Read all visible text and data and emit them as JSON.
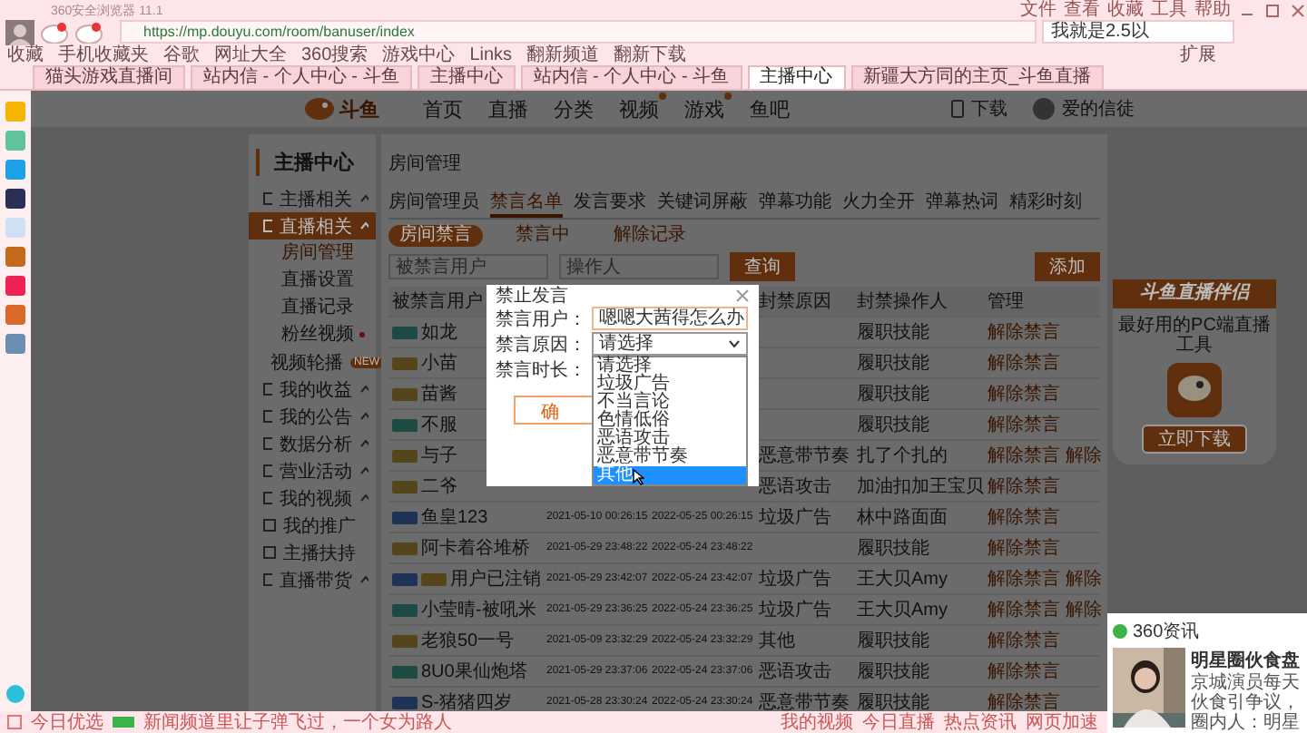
{
  "browser": {
    "title": "360安全浏览器 11.1",
    "url": "https://mp.douyu.com/room/banuser/index",
    "search": "我就是2.5以",
    "menu": [
      "文件",
      "查看",
      "收藏",
      "工具",
      "帮助"
    ],
    "bookmarks": [
      "收藏",
      "手机收藏夹",
      "谷歌",
      "网址大全",
      "360搜索",
      "游戏中心",
      "Links",
      "翻新频道",
      "翻新下载"
    ],
    "bookmarks_right": [
      "扩展"
    ],
    "tabs": [
      {
        "label": "猫头游戏直播间",
        "selected": false
      },
      {
        "label": "站内信 - 个人中心 - 斗鱼",
        "selected": false
      },
      {
        "label": "主播中心",
        "selected": false
      },
      {
        "label": "站内信 - 个人中心 - 斗鱼",
        "selected": false
      },
      {
        "label": "主播中心",
        "selected": true
      },
      {
        "label": "新疆大方同的主页_斗鱼直播",
        "selected": false
      }
    ]
  },
  "site": {
    "logo": "斗鱼",
    "nav": [
      {
        "label": "首页",
        "badge": false
      },
      {
        "label": "直播",
        "badge": false
      },
      {
        "label": "分类",
        "badge": false
      },
      {
        "label": "视频",
        "badge": true
      },
      {
        "label": "游戏",
        "badge": true
      },
      {
        "label": "鱼吧",
        "badge": false
      }
    ],
    "download": "下载",
    "username": "爱的信徒"
  },
  "side_menu": {
    "title": "主播中心",
    "items": [
      {
        "label": "主播相关",
        "expandable": true,
        "selected": false
      },
      {
        "label": "直播相关",
        "expandable": true,
        "selected": true,
        "children": [
          {
            "label": "房间管理",
            "selected": true,
            "dot": false
          },
          {
            "label": "直播设置",
            "selected": false,
            "dot": false
          },
          {
            "label": "直播记录",
            "selected": false,
            "dot": false
          },
          {
            "label": "粉丝视频",
            "selected": false,
            "dot": true
          }
        ]
      },
      {
        "label": "视频轮播",
        "expandable": false,
        "selected": false,
        "badge": "NEW"
      },
      {
        "label": "我的收益",
        "expandable": true,
        "selected": false
      },
      {
        "label": "我的公告",
        "expandable": true,
        "selected": false
      },
      {
        "label": "数据分析",
        "expandable": true,
        "selected": false
      },
      {
        "label": "营业活动",
        "expandable": true,
        "selected": false
      },
      {
        "label": "我的视频",
        "expandable": true,
        "selected": false
      },
      {
        "label": "我的推广",
        "expandable": false,
        "selected": false
      },
      {
        "label": "主播扶持",
        "expandable": false,
        "selected": false
      },
      {
        "label": "直播带货",
        "expandable": true,
        "selected": false
      }
    ]
  },
  "main": {
    "title": "房间管理",
    "tabs": [
      {
        "label": "房间管理员",
        "selected": false
      },
      {
        "label": "禁言名单",
        "selected": true
      },
      {
        "label": "发言要求",
        "selected": false
      },
      {
        "label": "关键词屏蔽",
        "selected": false
      },
      {
        "label": "弹幕功能",
        "selected": false
      },
      {
        "label": "火力全开",
        "selected": false
      },
      {
        "label": "弹幕热词",
        "selected": false
      },
      {
        "label": "精彩时刻",
        "selected": false
      }
    ],
    "filters": [
      {
        "label": "房间禁言",
        "selected": true
      },
      {
        "label": "禁言中",
        "selected": false
      },
      {
        "label": "解除记录",
        "selected": false
      }
    ],
    "search": [
      {
        "placeholder": "被禁言用户"
      },
      {
        "placeholder": "操作人"
      }
    ],
    "query_button": "查询",
    "add_button": "添加",
    "table": {
      "columns": {
        "column_1": "被禁言用户",
        "column_4": "封禁原因",
        "column_5": "封禁操作人",
        "column_6": "管理"
      },
      "rows": [
        {
          "badges": [
            {
              "color": "#1e4a44"
            }
          ],
          "user": "如龙",
          "operator": "履职技能",
          "actions": [
            "解除禁言"
          ]
        },
        {
          "badges": [
            {
              "color": "#54461a"
            }
          ],
          "user": "小苗",
          "operator": "履职技能",
          "actions": [
            "解除禁言"
          ]
        },
        {
          "badges": [
            {
              "color": "#54461a"
            }
          ],
          "user": "苗酱",
          "operator": "履职技能",
          "actions": [
            "解除禁言"
          ]
        },
        {
          "badges": [
            {
              "color": "#1e4a44"
            }
          ],
          "user": "不服",
          "operator": "履职技能",
          "actions": [
            "解除禁言"
          ]
        },
        {
          "badges": [
            {
              "color": "#54461a"
            }
          ],
          "user": "与子",
          "reason": "恶意带节奏",
          "operator": "扎了个扎的",
          "actions": [
            "解除禁言",
            "解除"
          ]
        },
        {
          "badges": [
            {
              "color": "#54461a"
            }
          ],
          "user": "二爷",
          "reason": "恶语攻击",
          "operator": "加油扣加王宝贝",
          "actions": [
            "解除禁言"
          ]
        },
        {
          "badges": [
            {
              "color": "#1e3356"
            }
          ],
          "user": "鱼皇123",
          "banned": "2021-05-10 00:26:15",
          "expires": "2022-05-25 00:26:15",
          "reason": "垃圾广告",
          "operator": "林中路面面",
          "actions": [
            "解除禁言"
          ]
        },
        {
          "badges": [
            {
              "color": "#54461a"
            }
          ],
          "user": "阿卡着谷堆桥",
          "banned": "2021-05-29 23:48:22",
          "expires": "2022-05-24 23:48:22",
          "operator": "履职技能",
          "actions": [
            "解除禁言"
          ]
        },
        {
          "badges": [
            {
              "color": "#1e3356"
            },
            {
              "color": "#54461a"
            }
          ],
          "user": "用户已注销",
          "banned": "2021-05-29 23:42:07",
          "expires": "2022-05-24 23:42:07",
          "reason": "垃圾广告",
          "operator": "王大贝Amy",
          "actions": [
            "解除禁言",
            "解除"
          ]
        },
        {
          "badges": [
            {
              "color": "#1e4a44"
            }
          ],
          "user": "小莹晴-被吼米",
          "banned": "2021-05-29 23:36:25",
          "expires": "2022-05-24 23:36:25",
          "reason": "垃圾广告",
          "operator": "王大贝Amy",
          "actions": [
            "解除禁言",
            "解除"
          ]
        },
        {
          "badges": [
            {
              "color": "#54461a"
            }
          ],
          "user": "老狼50一号",
          "banned": "2021-05-09 23:32:29",
          "expires": "2022-05-24 23:32:29",
          "reason": "其他",
          "operator": "履职技能",
          "actions": [
            "解除禁言"
          ]
        },
        {
          "badges": [
            {
              "color": "#1e4a44"
            }
          ],
          "user": "8U0果仙炮塔",
          "banned": "2021-05-29 23:37:06",
          "expires": "2022-05-24 23:37:06",
          "reason": "恶语攻击",
          "operator": "履职技能",
          "actions": [
            "解除禁言"
          ]
        },
        {
          "badges": [
            {
              "color": "#1e3356"
            }
          ],
          "user": "S-猪猪四岁",
          "banned": "2021-05-28 23:30:24",
          "expires": "2022-05-24 23:30:24",
          "reason": "恶意带节奏",
          "operator": "履职技能",
          "actions": [
            "解除禁言"
          ]
        }
      ]
    }
  },
  "ad": {
    "title": "斗鱼直播伴侣",
    "text": "最好用的PC端直播工具",
    "button": "立即下载"
  },
  "dialog": {
    "title": "禁止发言",
    "user_label": "禁言用户：",
    "user_value": "嗯嗯大茜得怎么办",
    "reason_label": "禁言原因：",
    "reason_value": "请选择",
    "duration_label": "禁言时长：",
    "confirm": "确",
    "options": [
      {
        "label": "请选择",
        "selected": false
      },
      {
        "label": "垃圾广告",
        "selected": false
      },
      {
        "label": "不当言论",
        "selected": false
      },
      {
        "label": "色情低俗",
        "selected": false
      },
      {
        "label": "恶语攻击",
        "selected": false
      },
      {
        "label": "恶意带节奏",
        "selected": false
      },
      {
        "label": "其他",
        "selected": true
      }
    ]
  },
  "news_popup": {
    "source": "360资讯",
    "headline": "明星圈伙食盘",
    "summary": "京城演员每天伙食引争议，圈内人：明星"
  },
  "status_bar": {
    "left": "今日优选",
    "ticker": "新闻频道里让子弹飞过，一个女为路人",
    "right": [
      "我的视频",
      "今日直播",
      "热点资讯",
      "网页加速"
    ]
  }
}
